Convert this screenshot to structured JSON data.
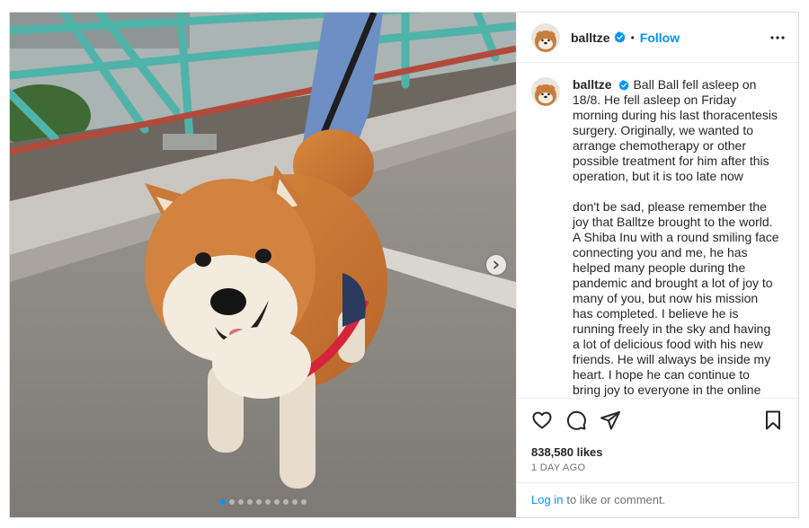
{
  "user": {
    "username": "balltze",
    "follow_label": "Follow",
    "separator": "•"
  },
  "caption": {
    "username": "balltze",
    "paragraph1": "Ball Ball fell asleep on 18/8. He fell asleep on Friday morning during his last thoracentesis surgery. Originally, we wanted to arrange chemotherapy or other possible treatment for him after this operation, but it is too late now",
    "paragraph2": "don't be sad, please remember the joy that Balltze brought to the world. A Shiba Inu with a round smiling face connecting you and me, he has helped many people during the pandemic and brought a lot of joy to many of you, but now his mission has completed. I believe he is running freely in the sky and having a lot of delicious food with his new friends. He will always be inside my heart. I hope he can continue to bring joy to everyone in the online world, that's my only humble request."
  },
  "stats": {
    "likes": "838,580 likes",
    "time": "1 DAY AGO"
  },
  "login": {
    "link": "Log in",
    "text": "to like or comment."
  },
  "carousel": {
    "total": 10,
    "active_index": 1
  },
  "icons": [
    "more-options-icon",
    "heart-icon",
    "comment-icon",
    "share-icon",
    "save-icon",
    "chevron-right-icon",
    "verified-badge-icon"
  ],
  "colors": {
    "accent": "#0095f6",
    "verified": "#0095f6",
    "text": "#262626",
    "muted": "#737373"
  }
}
